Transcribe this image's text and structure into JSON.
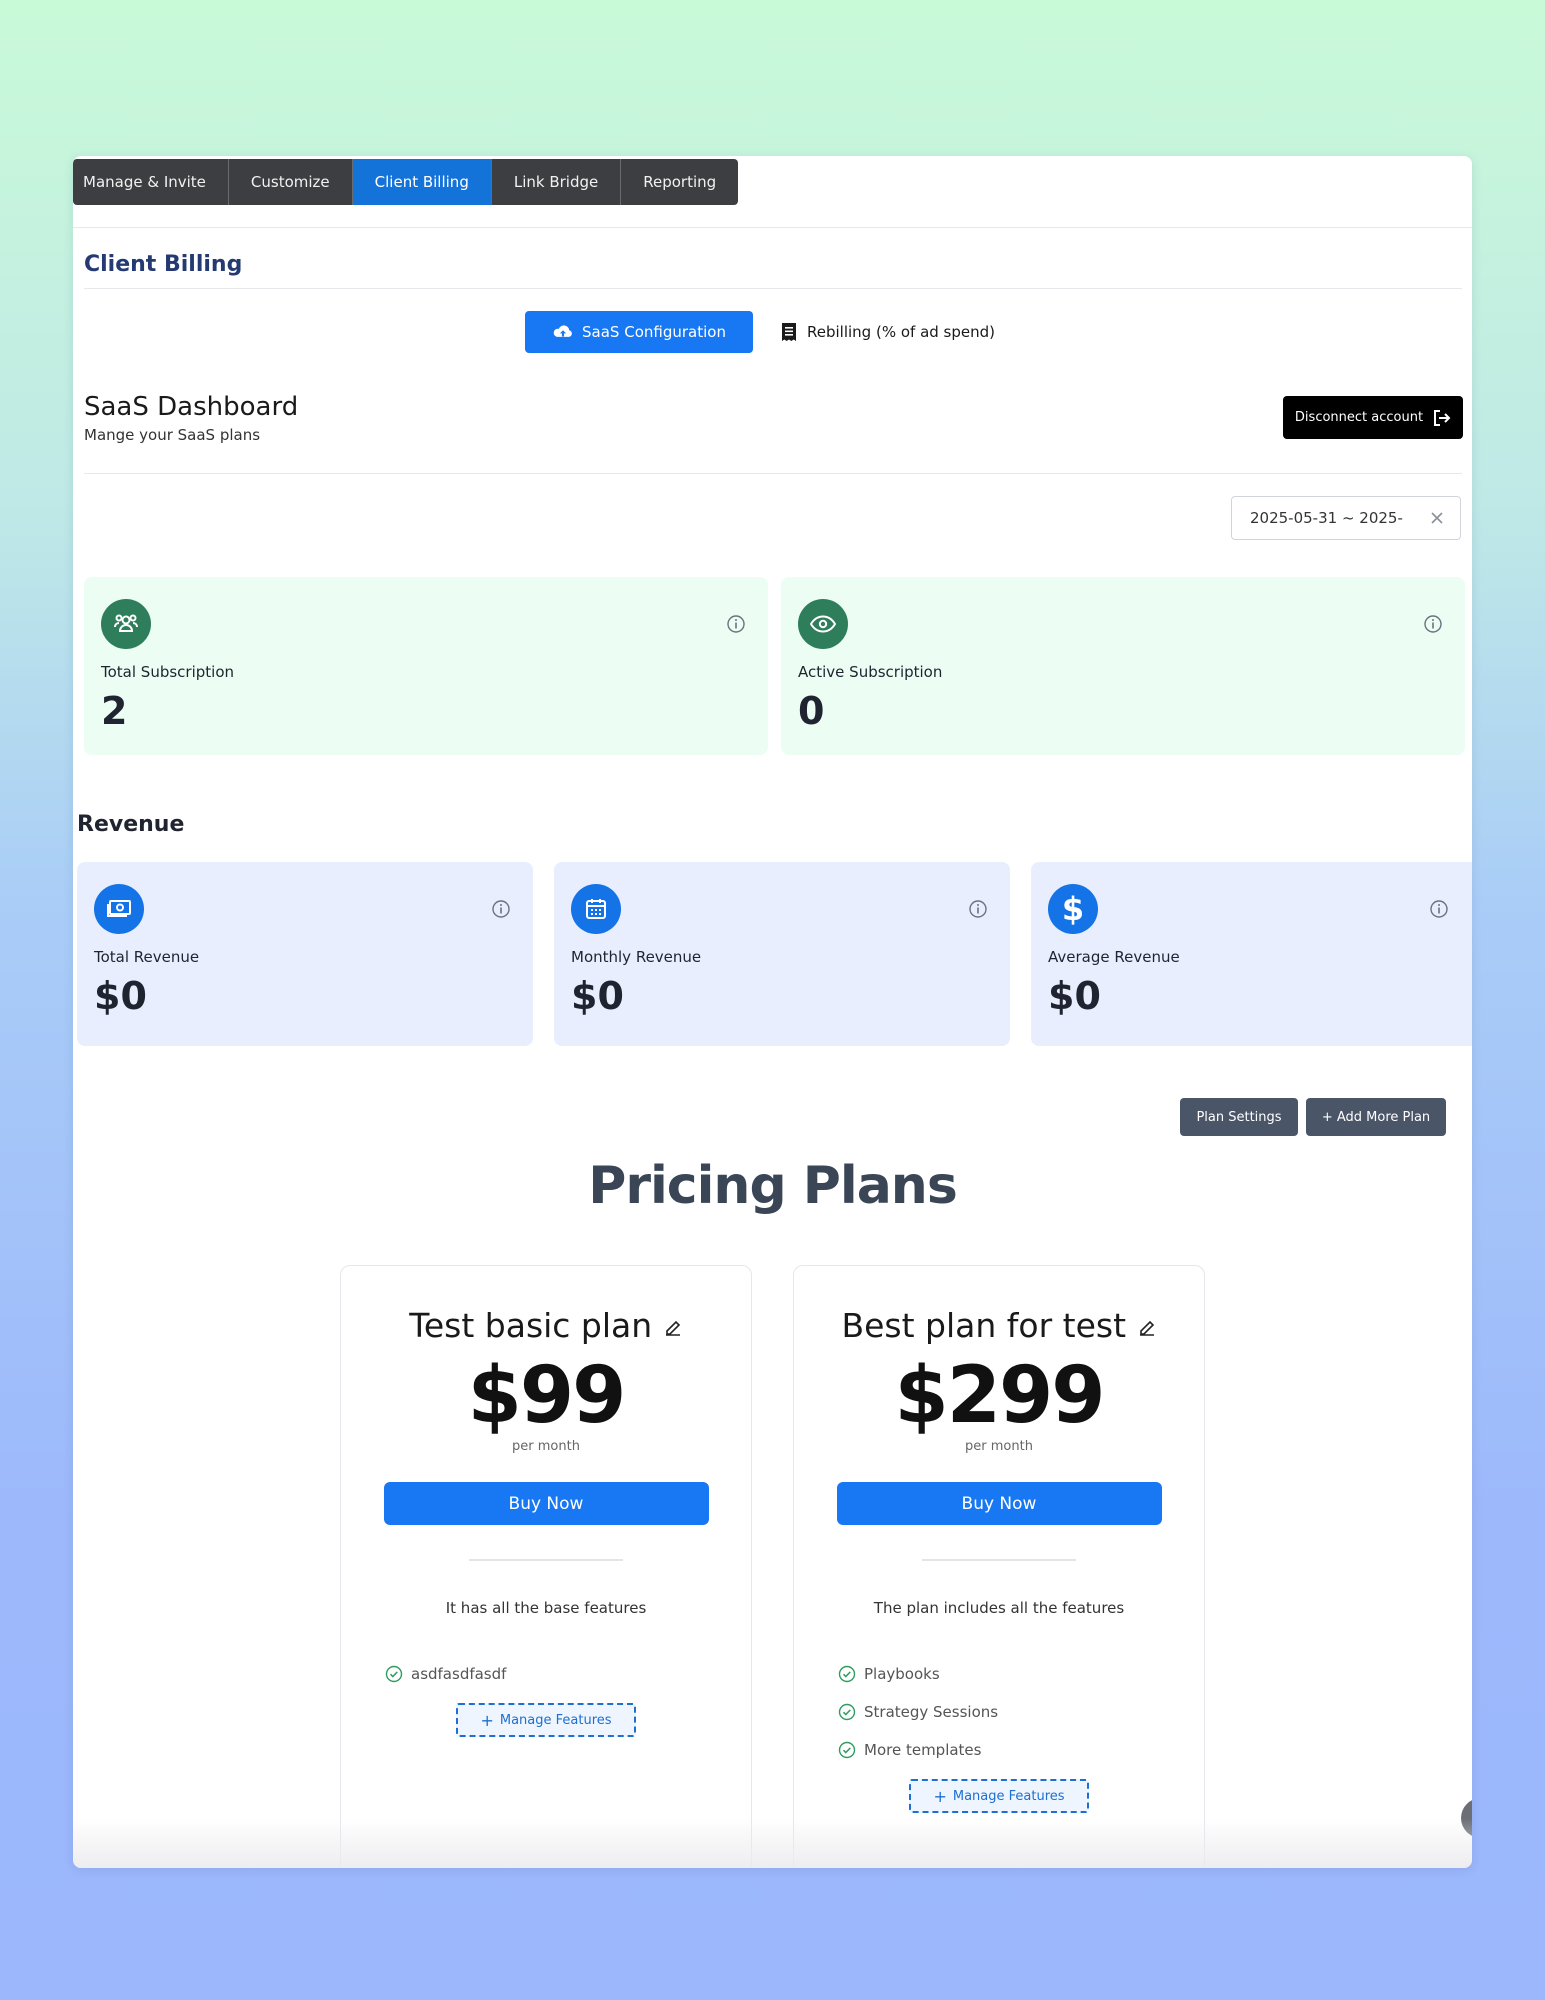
{
  "tabs": [
    "Manage & Invite",
    "Customize",
    "Client Billing",
    "Link Bridge",
    "Reporting"
  ],
  "active_tab": "Client Billing",
  "page_title": "Client Billing",
  "billing_modes": {
    "saas": "SaaS Configuration",
    "rebilling": "Rebilling (% of ad spend)"
  },
  "dashboard": {
    "title": "SaaS Dashboard",
    "subtitle": "Mange your SaaS plans",
    "disconnect_label": "Disconnect account"
  },
  "date_range": {
    "value": "2025-05-31 ~ 2025-"
  },
  "subscriptions": {
    "total_label": "Total Subscription",
    "total_value": "2",
    "active_label": "Active Subscription",
    "active_value": "0"
  },
  "revenue": {
    "title": "Revenue",
    "total_label": "Total Revenue",
    "total_value": "$0",
    "monthly_label": "Monthly Revenue",
    "monthly_value": "$0",
    "average_label": "Average Revenue",
    "average_value": "$0"
  },
  "pricing": {
    "plan_settings_label": "Plan Settings",
    "add_plan_label": "+ Add More Plan",
    "title": "Pricing Plans",
    "plans": [
      {
        "name": "Test basic plan",
        "price": "$99",
        "period": "per month",
        "buy_label": "Buy Now",
        "description": "It has all the base features",
        "features": [
          "asdfasdfasdf"
        ],
        "manage_label": "Manage Features"
      },
      {
        "name": "Best plan for test",
        "price": "$299",
        "period": "per month",
        "buy_label": "Buy Now",
        "description": "The plan includes all the features",
        "features": [
          "Playbooks",
          "Strategy Sessions",
          "More templates"
        ],
        "manage_label": "Manage Features"
      }
    ]
  },
  "colors": {
    "accent_blue": "#1877f2",
    "green_card": "#ecfdf3",
    "blue_card": "#e8eefe"
  }
}
